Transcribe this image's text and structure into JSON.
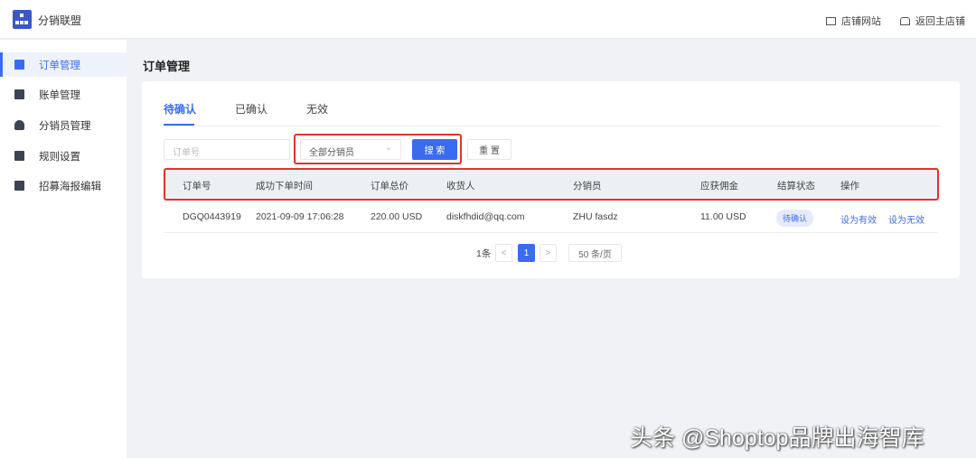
{
  "header": {
    "app_title": "分销联盟",
    "store_site": "店铺网站",
    "back_to_store": "返回主店铺"
  },
  "sidebar": {
    "items": [
      {
        "label": "订单管理",
        "icon": "order-icon",
        "active": true
      },
      {
        "label": "账单管理",
        "icon": "yen-bill-icon"
      },
      {
        "label": "分销员管理",
        "icon": "users-icon"
      },
      {
        "label": "规则设置",
        "icon": "rules-icon"
      },
      {
        "label": "招募海报编辑",
        "icon": "image-icon"
      }
    ]
  },
  "page": {
    "title": "订单管理"
  },
  "tabs": [
    "待确认",
    "已确认",
    "无效"
  ],
  "filters": {
    "order_placeholder": "订单号",
    "distributor_select": "全部分销员",
    "search": "搜 索",
    "reset": "重 置"
  },
  "table": {
    "headers": [
      "订单号",
      "成功下单时间",
      "订单总价",
      "收货人",
      "分销员",
      "应获佣金",
      "结算状态",
      "操作"
    ],
    "rows": [
      {
        "order_no": "DGQ0443919",
        "time": "2021-09-09 17:06:28",
        "total": "220.00 USD",
        "receiver": "diskfhdid@qq.com",
        "distributor": "ZHU fasdz",
        "commission": "11.00 USD",
        "status": "待确认",
        "action_valid": "设为有效",
        "action_invalid": "设为无效"
      }
    ]
  },
  "pagination": {
    "total": "1条",
    "prev": "<",
    "current": "1",
    "next": ">",
    "page_size": "50 条/页"
  },
  "watermark": "头条 @Shoptop品牌出海智库",
  "colors": {
    "accent": "#3b6cf0",
    "highlight": "#e3322b"
  }
}
